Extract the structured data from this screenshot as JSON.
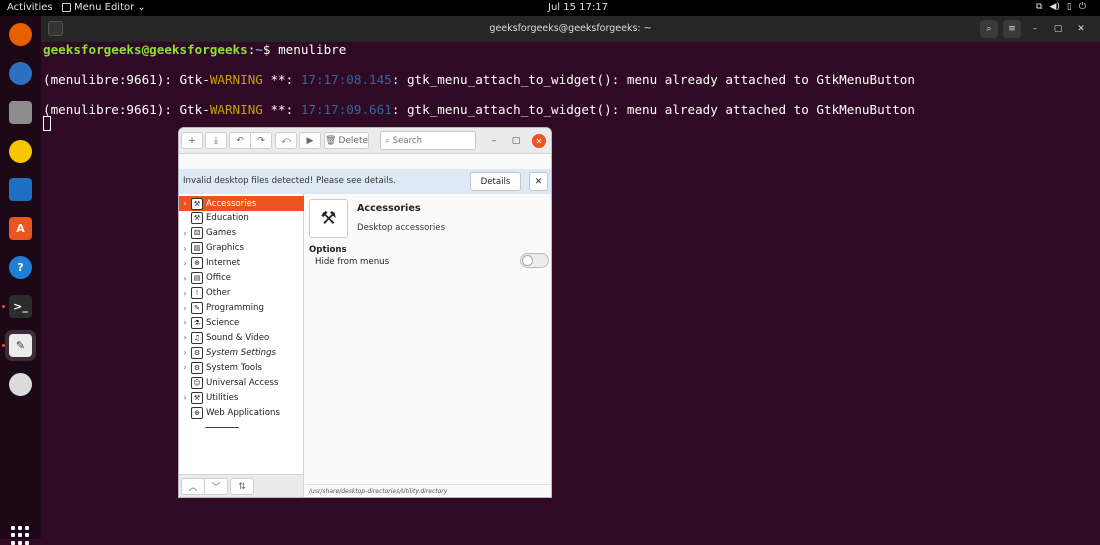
{
  "topbar": {
    "activities": "Activities",
    "app_menu_label": "Menu Editor",
    "clock": "Jul 15  17:17"
  },
  "dock": {
    "items": [
      {
        "name": "firefox-icon",
        "glyph": "",
        "color": "#e66000"
      },
      {
        "name": "thunderbird-icon",
        "glyph": "",
        "color": "#2f6fbf"
      },
      {
        "name": "files-icon",
        "glyph": "",
        "color": "#8c8c8c"
      },
      {
        "name": "rhythmbox-icon",
        "glyph": "",
        "color": "#f6c700"
      },
      {
        "name": "libreoffice-writer-icon",
        "glyph": "",
        "color": "#1f6fc5"
      },
      {
        "name": "app-center-icon",
        "glyph": "A",
        "color": "#e95420"
      },
      {
        "name": "help-icon",
        "glyph": "?",
        "color": "#1f7fd6"
      },
      {
        "name": "terminal-icon",
        "glyph": ">_",
        "color": "#2c2c2c"
      },
      {
        "name": "menu-editor-icon",
        "glyph": "✎",
        "color": "#ebebeb"
      },
      {
        "name": "disc-icon",
        "glyph": "",
        "color": "#dcdcdc"
      }
    ]
  },
  "terminal": {
    "title": "geeksforgeeks@geeksforgeeks: ~",
    "prompt_user": "geeksforgeeks@geeksforgeeks",
    "prompt_sep": ":",
    "prompt_path": "~",
    "prompt_symbol": "$ ",
    "command": "menulibre",
    "lines": [
      {
        "prefix": "(menulibre:9661): Gtk-",
        "level": "WARNING",
        "mid": " **: ",
        "time": "17:17:08.145",
        "msg": ": gtk_menu_attach_to_widget(): menu already attached to GtkMenuButton"
      },
      {
        "prefix": "(menulibre:9661): Gtk-",
        "level": "WARNING",
        "mid": " **: ",
        "time": "17:17:09.661",
        "msg": ": gtk_menu_attach_to_widget(): menu already attached to GtkMenuButton"
      }
    ]
  },
  "editor": {
    "toolbar": {
      "delete_label": "Delete",
      "search_placeholder": "Search"
    },
    "infobar": {
      "message": "Invalid desktop files detected! Please see details.",
      "details_label": "Details"
    },
    "categories": [
      {
        "label": "Accessories",
        "expand": true,
        "selected": true,
        "italic": false,
        "glyph": "⚒"
      },
      {
        "label": "Education",
        "expand": false,
        "selected": false,
        "italic": false,
        "glyph": "⚒"
      },
      {
        "label": "Games",
        "expand": true,
        "selected": false,
        "italic": false,
        "glyph": "⚄"
      },
      {
        "label": "Graphics",
        "expand": true,
        "selected": false,
        "italic": false,
        "glyph": "▨"
      },
      {
        "label": "Internet",
        "expand": true,
        "selected": false,
        "italic": false,
        "glyph": "⊕"
      },
      {
        "label": "Office",
        "expand": true,
        "selected": false,
        "italic": false,
        "glyph": "▤"
      },
      {
        "label": "Other",
        "expand": true,
        "selected": false,
        "italic": false,
        "glyph": "⁞"
      },
      {
        "label": "Programming",
        "expand": true,
        "selected": false,
        "italic": false,
        "glyph": "✎"
      },
      {
        "label": "Science",
        "expand": true,
        "selected": false,
        "italic": false,
        "glyph": "⚗"
      },
      {
        "label": "Sound & Video",
        "expand": true,
        "selected": false,
        "italic": false,
        "glyph": "♫"
      },
      {
        "label": "System Settings",
        "expand": true,
        "selected": false,
        "italic": true,
        "glyph": "⚙"
      },
      {
        "label": "System Tools",
        "expand": true,
        "selected": false,
        "italic": false,
        "glyph": "⚙"
      },
      {
        "label": "Universal Access",
        "expand": false,
        "selected": false,
        "italic": false,
        "glyph": "☺"
      },
      {
        "label": "Utilities",
        "expand": true,
        "selected": false,
        "italic": false,
        "glyph": "⚒"
      },
      {
        "label": "Web Applications",
        "expand": false,
        "selected": false,
        "italic": false,
        "glyph": "⊕"
      }
    ],
    "detail": {
      "name": "Accessories",
      "comment": "Desktop accessories",
      "options_label": "Options",
      "hide_from_menus_label": "Hide from menus",
      "hide_from_menus": false
    },
    "status_path": "/usr/share/desktop-directories/Utility.directory"
  }
}
